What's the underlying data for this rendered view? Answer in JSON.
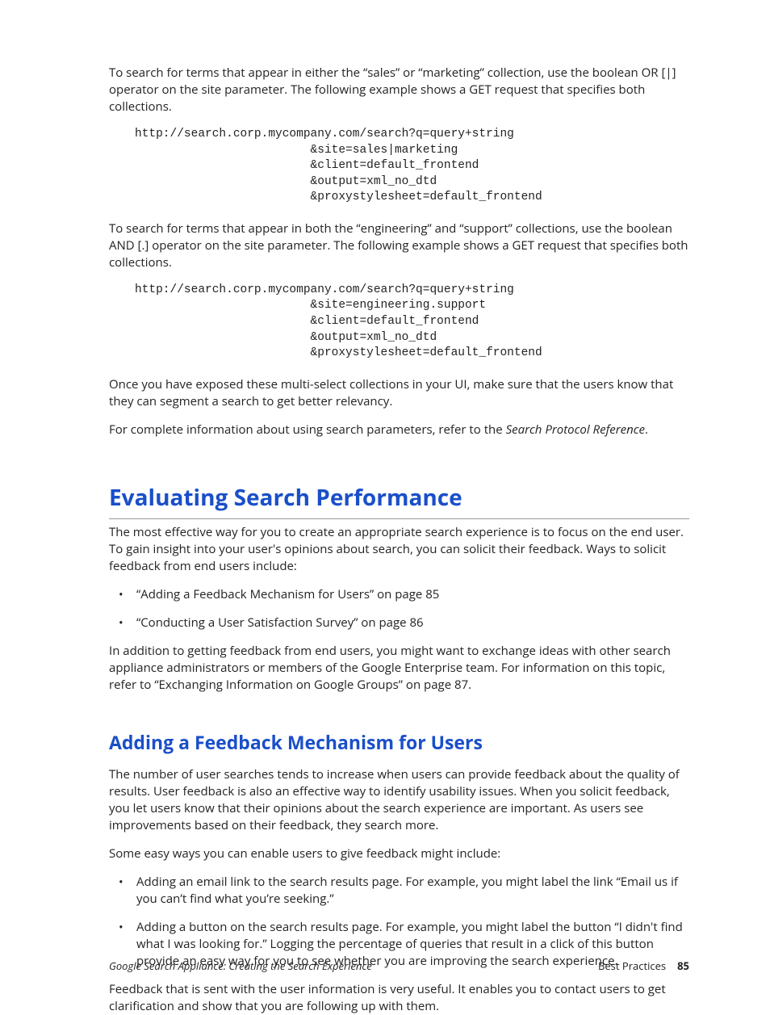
{
  "para1": "To search for terms that appear in either the “sales” or “marketing” collection, use the boolean OR [|] operator on the site parameter. The following example shows a GET request that specifies both collections.",
  "code1": "http://search.corp.mycompany.com/search?q=query+string\n                         &site=sales|marketing\n                         &client=default_frontend\n                         &output=xml_no_dtd\n                         &proxystylesheet=default_frontend",
  "para2": "To search for terms that appear in both the “engineering” and “support” collections, use the boolean AND [.] operator on the site parameter. The following example shows a GET request that specifies both collections.",
  "code2": "http://search.corp.mycompany.com/search?q=query+string\n                         &site=engineering.support\n                         &client=default_frontend\n                         &output=xml_no_dtd\n                         &proxystylesheet=default_frontend",
  "para3": "Once you have exposed these multi-select collections in your UI, make sure that the users know that they can segment a search to get better relevancy.",
  "para4_a": "For complete information about using search parameters, refer to the ",
  "para4_b": "Search Protocol Reference",
  "para4_c": ".",
  "h1": "Evaluating Search Performance",
  "para5": "The most effective way for you to create an appropriate search experience is to focus on the end user. To gain insight into your user's opinions about search, you can solicit their feedback. Ways to solicit feedback from end users include:",
  "list1": {
    "i0": "“Adding a Feedback Mechanism for Users” on page 85",
    "i1": "“Conducting a User Satisfaction Survey” on page 86"
  },
  "para6": "In addition to getting feedback from end users, you might want to exchange ideas with other search appliance administrators or members of the Google Enterprise team. For information on this topic, refer to “Exchanging Information on Google Groups” on page 87.",
  "h2": "Adding a Feedback Mechanism for Users",
  "para7": "The number of user searches tends to increase when users can provide feedback about the quality of results. User feedback is also an effective way to identify usability issues. When you solicit feedback, you let users know that their opinions about the search experience are important. As users see improvements based on their feedback, they search more.",
  "para8": "Some easy ways you can enable users to give feedback might include:",
  "list2": {
    "i0": "Adding an email link to the search results page. For example, you might label the link “Email us if you can’t find what you’re seeking.”",
    "i1": "Adding a button on the search results page. For example, you might label the button “I didn't find what I was looking for.” Logging the percentage of queries that result in a click of this button provide an easy way for you to see whether you are improving the search experience."
  },
  "para9": "Feedback that is sent with the user information is very useful. It enables you to contact users to get clarification and show that you are following up with them.",
  "footer": {
    "left": "Google Search Appliance: Creating the Search Experience",
    "right_label": "Best Practices",
    "page": "85"
  }
}
